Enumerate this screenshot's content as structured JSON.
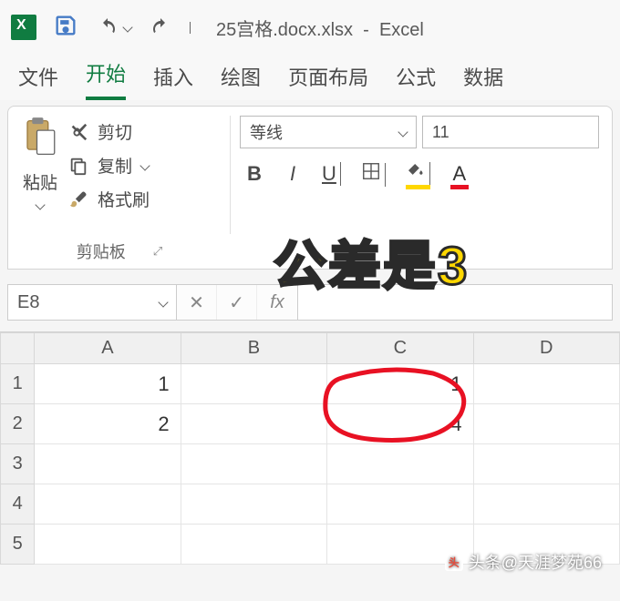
{
  "title": {
    "filename": "25宫格.docx.xlsx",
    "app": "Excel"
  },
  "tabs": {
    "file": "文件",
    "home": "开始",
    "insert": "插入",
    "draw": "绘图",
    "layout": "页面布局",
    "formula": "公式",
    "data": "数据"
  },
  "ribbon": {
    "paste": "粘贴",
    "cut": "剪切",
    "copy": "复制",
    "format_painter": "格式刷",
    "clipboard_label": "剪贴板",
    "font_name": "等线",
    "font_size": "11"
  },
  "namebox": {
    "ref": "E8"
  },
  "overlay": {
    "text": "公差是3"
  },
  "grid": {
    "cols": [
      "A",
      "B",
      "C",
      "D"
    ],
    "rows": [
      "1",
      "2",
      "3",
      "4",
      "5"
    ],
    "cells": {
      "A1": "1",
      "A2": "2",
      "C1": "1",
      "C2": "4"
    }
  },
  "watermark": {
    "text": "头条@天涯梦苑66"
  },
  "chart_data": {
    "type": "table",
    "title": "Excel cells showing arithmetic sequence with common difference 3",
    "data": [
      {
        "cell": "A1",
        "value": 1
      },
      {
        "cell": "A2",
        "value": 2
      },
      {
        "cell": "C1",
        "value": 1
      },
      {
        "cell": "C2",
        "value": 4
      }
    ],
    "annotation": "公差是3 (common difference is 3, referring to C1=1, C2=4)"
  }
}
